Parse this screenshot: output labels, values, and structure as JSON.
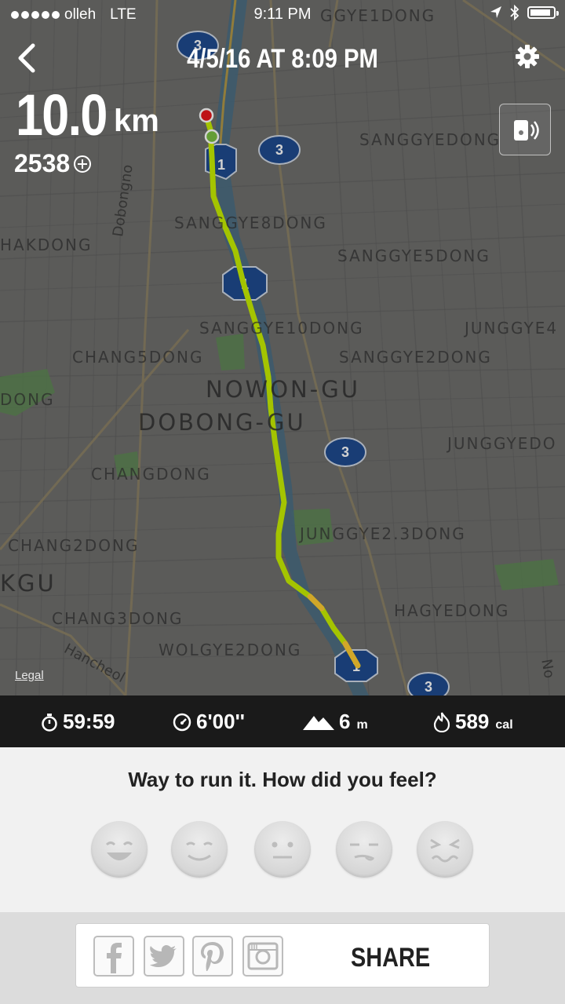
{
  "status_bar": {
    "carrier": "olleh",
    "network": "LTE",
    "time": "9:11 PM",
    "battery_level": 0.9
  },
  "header": {
    "title": "4/5/16 AT 8:09 PM",
    "back_icon": "chevron-left-icon",
    "settings_icon": "gear-icon",
    "audio_icon": "audio-feedback-icon"
  },
  "summary": {
    "distance_value": "10.0",
    "distance_unit": "km",
    "fuel": "2538",
    "fuel_icon": "plus-circle-icon"
  },
  "map": {
    "districts": [
      "GGYE1DONG",
      "SANGGYEDONG",
      "SANGGYE8DONG",
      "HAKDONG",
      "SANGGYE5DONG",
      "SANGGYE10DONG",
      "JUNGGYE4",
      "CHANG5DONG",
      "SANGGYE2DONG",
      "NOWON-GU",
      "DONG",
      "DOBONG-GU",
      "JUNGGYEDO",
      "CHANGDONG",
      "JUNGGYE2.3DONG",
      "CHANG2DONG",
      "KGU",
      "HAGYEDONG",
      "CHANG3DONG",
      "WOLGYE2DONG"
    ],
    "roads": [
      "Dobongno",
      "Hancheol",
      "No"
    ],
    "highway_shields": [
      "3",
      "1",
      "3",
      "1",
      "3",
      "1",
      "3"
    ],
    "legal_link": "Legal",
    "route_color": "#c8f000",
    "start_color": "#7bc043",
    "end_color": "#e8171b"
  },
  "stats": {
    "duration": "59:59",
    "pace": "6'00''",
    "elevation_value": "6",
    "elevation_unit": "m",
    "calories_value": "589",
    "calories_unit": "cal",
    "icons": [
      "stopwatch-icon",
      "speedometer-icon",
      "mountain-icon",
      "flame-icon"
    ]
  },
  "feedback": {
    "prompt": "Way to run it. How did you feel?",
    "faces": [
      "awesome-face",
      "happy-face",
      "neutral-face",
      "meh-face",
      "tired-face"
    ]
  },
  "share": {
    "label": "SHARE",
    "networks": [
      "facebook-icon",
      "twitter-icon",
      "pinterest-icon",
      "instagram-icon"
    ]
  }
}
